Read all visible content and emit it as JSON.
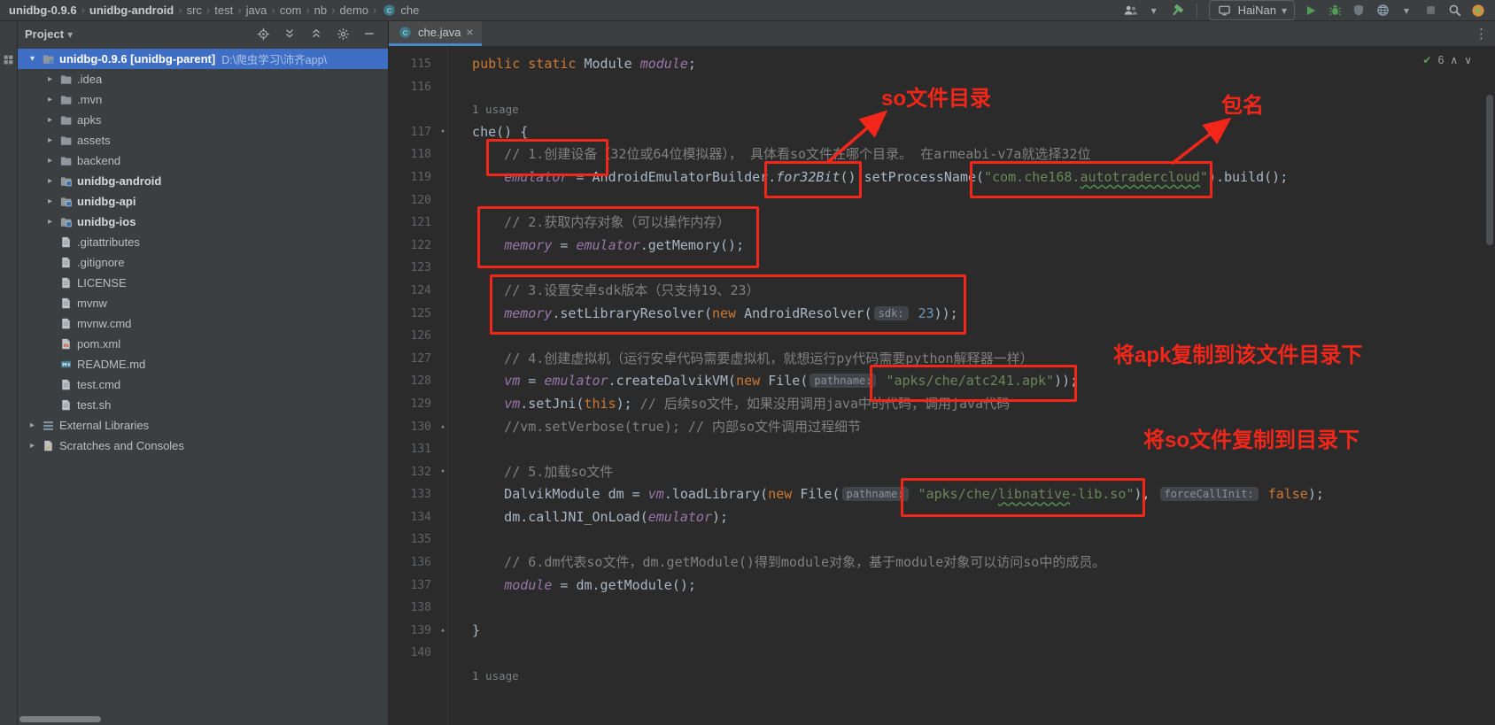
{
  "colors": {
    "annotation_red": "#f3261a",
    "selection_blue": "#3f6fc5",
    "editor_background": "#2b2b2b",
    "panel_background": "#3c3f41"
  },
  "topbar": {
    "breadcrumbs": [
      {
        "label": "unidbg-0.9.6",
        "bold": true
      },
      {
        "label": "unidbg-android",
        "bold": true
      },
      {
        "label": "src"
      },
      {
        "label": "test"
      },
      {
        "label": "java"
      },
      {
        "label": "com"
      },
      {
        "label": "nb"
      },
      {
        "label": "demo"
      },
      {
        "label": "che",
        "icon": "class-icon"
      }
    ],
    "actions_left": [
      "users-icon",
      "chevron-down-icon",
      "build-hammer-icon"
    ],
    "run_config": "HaiNan",
    "device_icon": "monitor-icon",
    "actions_right": [
      "run-icon",
      "debug-icon",
      "coverage-icon",
      "browser-icon",
      "chevron-down-icon",
      "stop-icon",
      "search-icon",
      "status-indicator-icon"
    ]
  },
  "project": {
    "title": "Project",
    "header_icons": [
      "locate-icon",
      "expand-all-icon",
      "collapse-all-icon",
      "settings-gear-icon",
      "hide-icon"
    ],
    "tree": [
      {
        "label": "unidbg-0.9.6 [unidbg-parent]",
        "path": "D:\\爬虫学习\\沛齐app\\",
        "icon": "folder-root-icon",
        "chevron": "open",
        "level": 0,
        "selected": true,
        "bold": true
      },
      {
        "label": ".idea",
        "icon": "folder-icon",
        "chevron": "closed",
        "level": 1
      },
      {
        "label": ".mvn",
        "icon": "folder-icon",
        "chevron": "closed",
        "level": 1
      },
      {
        "label": "apks",
        "icon": "folder-icon",
        "chevron": "closed",
        "level": 1
      },
      {
        "label": "assets",
        "icon": "folder-icon",
        "chevron": "closed",
        "level": 1
      },
      {
        "label": "backend",
        "icon": "folder-icon",
        "chevron": "closed",
        "level": 1
      },
      {
        "label": "unidbg-android",
        "icon": "module-icon",
        "chevron": "closed",
        "level": 1,
        "bold": true
      },
      {
        "label": "unidbg-api",
        "icon": "module-icon",
        "chevron": "closed",
        "level": 1,
        "bold": true
      },
      {
        "label": "unidbg-ios",
        "icon": "module-icon",
        "chevron": "closed",
        "level": 1,
        "bold": true
      },
      {
        "label": ".gitattributes",
        "icon": "file-icon",
        "chevron": "none",
        "level": 1
      },
      {
        "label": ".gitignore",
        "icon": "file-icon",
        "chevron": "none",
        "level": 1
      },
      {
        "label": "LICENSE",
        "icon": "file-icon",
        "chevron": "none",
        "level": 1
      },
      {
        "label": "mvnw",
        "icon": "file-icon",
        "chevron": "none",
        "level": 1
      },
      {
        "label": "mvnw.cmd",
        "icon": "file-icon",
        "chevron": "none",
        "level": 1
      },
      {
        "label": "pom.xml",
        "icon": "maven-icon",
        "chevron": "none",
        "level": 1
      },
      {
        "label": "README.md",
        "icon": "markdown-icon",
        "chevron": "none",
        "level": 1
      },
      {
        "label": "test.cmd",
        "icon": "file-icon",
        "chevron": "none",
        "level": 1
      },
      {
        "label": "test.sh",
        "icon": "file-icon",
        "chevron": "none",
        "level": 1
      },
      {
        "label": "External Libraries",
        "icon": "libraries-icon",
        "chevron": "closed",
        "level": 0
      },
      {
        "label": "Scratches and Consoles",
        "icon": "scratches-icon",
        "chevron": "closed",
        "level": 0
      }
    ]
  },
  "editor": {
    "tab_label": "che.java",
    "tab_icon": "class-icon",
    "inspections_count": "6",
    "lines": [
      {
        "n": "115",
        "t": [
          [
            "k",
            "  public static "
          ],
          [
            "p",
            "Module "
          ],
          [
            "f",
            "module"
          ],
          [
            "p",
            ";"
          ]
        ]
      },
      {
        "n": "116",
        "t": []
      },
      {
        "usage": "1 usage"
      },
      {
        "n": "117",
        "fold": "down",
        "t": [
          [
            "p",
            "  che() {"
          ]
        ]
      },
      {
        "n": "118",
        "t": [
          [
            "c",
            "      // 1.创建设备（32位或64位模拟器）， 具体看so文件在哪个目录。 在armeabi-v7a就选择32位"
          ]
        ]
      },
      {
        "n": "119",
        "t": [
          [
            "p",
            "      "
          ],
          [
            "f",
            "emulator"
          ],
          [
            "p",
            " = AndroidEmulatorBuilder."
          ],
          [
            "i",
            "for32Bit"
          ],
          [
            "p",
            "().setProcessName("
          ],
          [
            "s",
            "\"com.che168."
          ],
          [
            "su",
            "autotradercloud"
          ],
          [
            "s",
            "\""
          ],
          [
            "p",
            ").build();"
          ]
        ]
      },
      {
        "n": "120",
        "t": []
      },
      {
        "n": "121",
        "t": [
          [
            "c",
            "      // 2.获取内存对象（可以操作内存）"
          ]
        ]
      },
      {
        "n": "122",
        "t": [
          [
            "p",
            "      "
          ],
          [
            "f",
            "memory"
          ],
          [
            "p",
            " = "
          ],
          [
            "f",
            "emulator"
          ],
          [
            "p",
            ".getMemory();"
          ]
        ]
      },
      {
        "n": "123",
        "t": []
      },
      {
        "n": "124",
        "t": [
          [
            "c",
            "      // 3.设置安卓sdk版本（只支持19、23）"
          ]
        ]
      },
      {
        "n": "125",
        "t": [
          [
            "p",
            "      "
          ],
          [
            "f",
            "memory"
          ],
          [
            "p",
            ".setLibraryResolver("
          ],
          [
            "k",
            "new"
          ],
          [
            "p",
            " AndroidResolver("
          ],
          [
            "h",
            "sdk:"
          ],
          [
            "p",
            " "
          ],
          [
            "n",
            "23"
          ],
          [
            "p",
            "));"
          ]
        ]
      },
      {
        "n": "126",
        "t": []
      },
      {
        "n": "127",
        "t": [
          [
            "c",
            "      // 4.创建虚拟机（运行安卓代码需要虚拟机，就想运行py代码需要python解释器一样）"
          ]
        ]
      },
      {
        "n": "128",
        "t": [
          [
            "p",
            "      "
          ],
          [
            "f",
            "vm"
          ],
          [
            "p",
            " = "
          ],
          [
            "f",
            "emulator"
          ],
          [
            "p",
            ".createDalvikVM("
          ],
          [
            "k",
            "new"
          ],
          [
            "p",
            " File("
          ],
          [
            "h",
            "pathname:"
          ],
          [
            "p",
            " "
          ],
          [
            "s",
            "\"apks/che/atc241.apk\""
          ],
          [
            "p",
            "));"
          ]
        ]
      },
      {
        "n": "129",
        "t": [
          [
            "p",
            "      "
          ],
          [
            "f",
            "vm"
          ],
          [
            "p",
            ".setJni("
          ],
          [
            "k",
            "this"
          ],
          [
            "p",
            "); "
          ],
          [
            "c",
            "// 后续so文件，如果没用调用java中的代码；调用java代码"
          ]
        ]
      },
      {
        "n": "130",
        "fold": "up",
        "t": [
          [
            "c",
            "      //vm.setVerbose(true); // 内部so文件调用过程细节"
          ]
        ]
      },
      {
        "n": "131",
        "t": []
      },
      {
        "n": "132",
        "fold": "down",
        "t": [
          [
            "c",
            "      // 5.加载so文件"
          ]
        ]
      },
      {
        "n": "133",
        "t": [
          [
            "p",
            "      DalvikModule dm = "
          ],
          [
            "f",
            "vm"
          ],
          [
            "p",
            ".loadLibrary("
          ],
          [
            "k",
            "new"
          ],
          [
            "p",
            " File("
          ],
          [
            "h",
            "pathname:"
          ],
          [
            "p",
            " "
          ],
          [
            "s",
            "\"apks/che/"
          ],
          [
            "su",
            "libnative"
          ],
          [
            "s",
            "-lib.so\""
          ],
          [
            "p",
            "), "
          ],
          [
            "h",
            "forceCallInit:"
          ],
          [
            "p",
            " "
          ],
          [
            "k",
            "false"
          ],
          [
            "p",
            ");"
          ]
        ]
      },
      {
        "n": "134",
        "t": [
          [
            "p",
            "      dm.callJNI_OnLoad("
          ],
          [
            "f",
            "emulator"
          ],
          [
            "p",
            ");"
          ]
        ]
      },
      {
        "n": "135",
        "t": []
      },
      {
        "n": "136",
        "t": [
          [
            "c",
            "      // 6.dm代表so文件，dm.getModule()得到module对象，基于module对象可以访问so中的成员。"
          ]
        ]
      },
      {
        "n": "137",
        "t": [
          [
            "p",
            "      "
          ],
          [
            "f",
            "module"
          ],
          [
            "p",
            " = dm.getModule();"
          ]
        ]
      },
      {
        "n": "138",
        "t": []
      },
      {
        "n": "139",
        "fold": "up",
        "t": [
          [
            "p",
            "  }"
          ]
        ]
      },
      {
        "n": "140",
        "t": []
      },
      {
        "usage": "1 usage"
      }
    ]
  },
  "annotations": {
    "so_dir": "so文件目录",
    "package_name": "包名",
    "apk_note": "将apk复制到该文件目录下",
    "so_note": "将so文件复制到目录下"
  }
}
